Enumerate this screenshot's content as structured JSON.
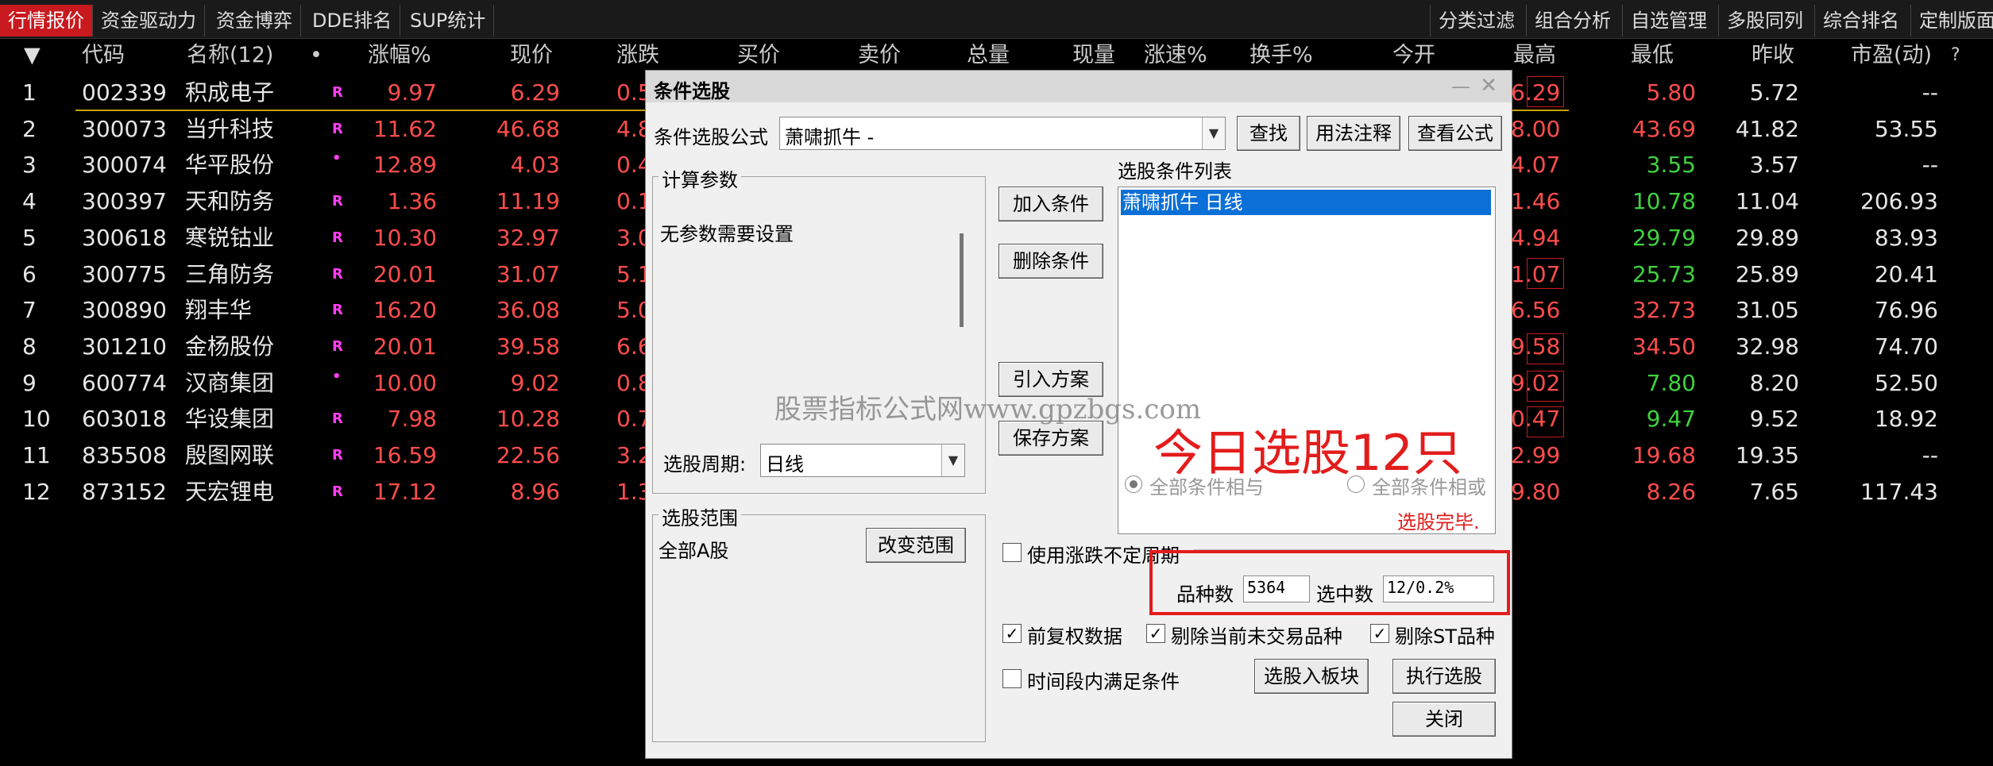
{
  "top_tabs": [
    "行情报价",
    "资金驱动力",
    "资金博弈",
    "DDE排名",
    "SUP统计"
  ],
  "right_tabs": [
    "分类过滤",
    "组合分析",
    "自选管理",
    "多股同列",
    "综合排名",
    "定制版面"
  ],
  "headers": {
    "sort": "▼",
    "code": "代码",
    "name": "名称(12)",
    "dot": "•",
    "pct": "涨幅%",
    "price": "现价",
    "chg": "涨跌",
    "bid": "买价",
    "ask": "卖价",
    "vol": "总量",
    "cur": "现量",
    "speed": "涨速%",
    "turn": "换手%",
    "open": "今开",
    "high": "最高",
    "low": "最低",
    "prev": "昨收",
    "pe": "市盈(动)",
    "q": "?"
  },
  "rows": [
    {
      "idx": "1",
      "code": "002339",
      "name": "积成电子",
      "mark": "R",
      "pct": "9.97",
      "price": "6.29",
      "chg": "0.5",
      "high": "6.29",
      "low": "5.80",
      "low_color": "red",
      "prev": "5.72",
      "pe": "--"
    },
    {
      "idx": "2",
      "code": "300073",
      "name": "当升科技",
      "mark": "R",
      "pct": "11.62",
      "price": "46.68",
      "chg": "4.8",
      "high": "8.00",
      "low": "43.69",
      "low_color": "red",
      "prev": "41.82",
      "pe": "53.55"
    },
    {
      "idx": "3",
      "code": "300074",
      "name": "华平股份",
      "mark": "•",
      "pct": "12.89",
      "price": "4.03",
      "chg": "0.4",
      "high": "4.07",
      "low": "3.55",
      "low_color": "green",
      "prev": "3.57",
      "pe": "--"
    },
    {
      "idx": "4",
      "code": "300397",
      "name": "天和防务",
      "mark": "R",
      "pct": "1.36",
      "price": "11.19",
      "chg": "0.1",
      "high": "1.46",
      "low": "10.78",
      "low_color": "green",
      "prev": "11.04",
      "pe": "206.93"
    },
    {
      "idx": "5",
      "code": "300618",
      "name": "寒锐钴业",
      "mark": "R",
      "pct": "10.30",
      "price": "32.97",
      "chg": "3.0",
      "high": "4.94",
      "low": "29.79",
      "low_color": "green",
      "prev": "29.89",
      "pe": "83.93"
    },
    {
      "idx": "6",
      "code": "300775",
      "name": "三角防务",
      "mark": "R",
      "pct": "20.01",
      "price": "31.07",
      "chg": "5.1",
      "high": "1.07",
      "low": "25.73",
      "low_color": "green",
      "prev": "25.89",
      "pe": "20.41"
    },
    {
      "idx": "7",
      "code": "300890",
      "name": "翔丰华",
      "mark": "R",
      "pct": "16.20",
      "price": "36.08",
      "chg": "5.0",
      "high": "6.56",
      "low": "32.73",
      "low_color": "red",
      "prev": "31.05",
      "pe": "76.96"
    },
    {
      "idx": "8",
      "code": "301210",
      "name": "金杨股份",
      "mark": "R",
      "pct": "20.01",
      "price": "39.58",
      "chg": "6.6",
      "high": "9.58",
      "low": "34.50",
      "low_color": "red",
      "prev": "32.98",
      "pe": "74.70"
    },
    {
      "idx": "9",
      "code": "600774",
      "name": "汉商集团",
      "mark": "•",
      "pct": "10.00",
      "price": "9.02",
      "chg": "0.8",
      "high": "9.02",
      "low": "7.80",
      "low_color": "green",
      "prev": "8.20",
      "pe": "52.50"
    },
    {
      "idx": "10",
      "code": "603018",
      "name": "华设集团",
      "mark": "R",
      "pct": "7.98",
      "price": "10.28",
      "chg": "0.7",
      "high": "0.47",
      "low": "9.47",
      "low_color": "green",
      "prev": "9.52",
      "pe": "18.92"
    },
    {
      "idx": "11",
      "code": "835508",
      "name": "殷图网联",
      "mark": "R",
      "pct": "16.59",
      "price": "22.56",
      "chg": "3.2",
      "high": "2.99",
      "low": "19.68",
      "low_color": "red",
      "prev": "19.35",
      "pe": "--"
    },
    {
      "idx": "12",
      "code": "873152",
      "name": "天宏锂电",
      "mark": "R",
      "pct": "17.12",
      "price": "8.96",
      "chg": "1.3",
      "high": "9.80",
      "low": "8.26",
      "low_color": "red",
      "prev": "7.65",
      "pe": "117.43"
    }
  ],
  "dialog": {
    "title": "条件选股",
    "formula_label": "条件选股公式",
    "formula_value": "萧啸抓牛  -",
    "find_btn": "查找",
    "usage_btn": "用法注释",
    "view_btn": "查看公式",
    "params_group": "计算参数",
    "params_text": "无参数需要设置",
    "period_label": "选股周期:",
    "period_value": "日线",
    "add_btn": "加入条件",
    "delete_btn": "删除条件",
    "import_btn": "引入方案",
    "save_btn": "保存方案",
    "list_label": "选股条件列表",
    "list_item": "萧啸抓牛  日线",
    "radio_and": "全部条件相与",
    "radio_or": "全部条件相或",
    "status": "选股完毕.",
    "range_group": "选股范围",
    "range_value": "全部A股",
    "change_range_btn": "改变范围",
    "use_period_label": "使用涨跌不定周期",
    "count_label": "品种数",
    "count_value": "5364",
    "selected_label": "选中数",
    "selected_value": "12/0.2%",
    "fq_label": "前复权数据",
    "exclude_label": "剔除当前未交易品种",
    "st_label": "剔除ST品种",
    "time_label": "时间段内满足条件",
    "to_block_btn": "选股入板块",
    "run_btn": "执行选股",
    "close_btn": "关闭"
  },
  "watermark": "股票指标公式网www.gpzbgs.com",
  "overlay_text": "今日选股12只"
}
